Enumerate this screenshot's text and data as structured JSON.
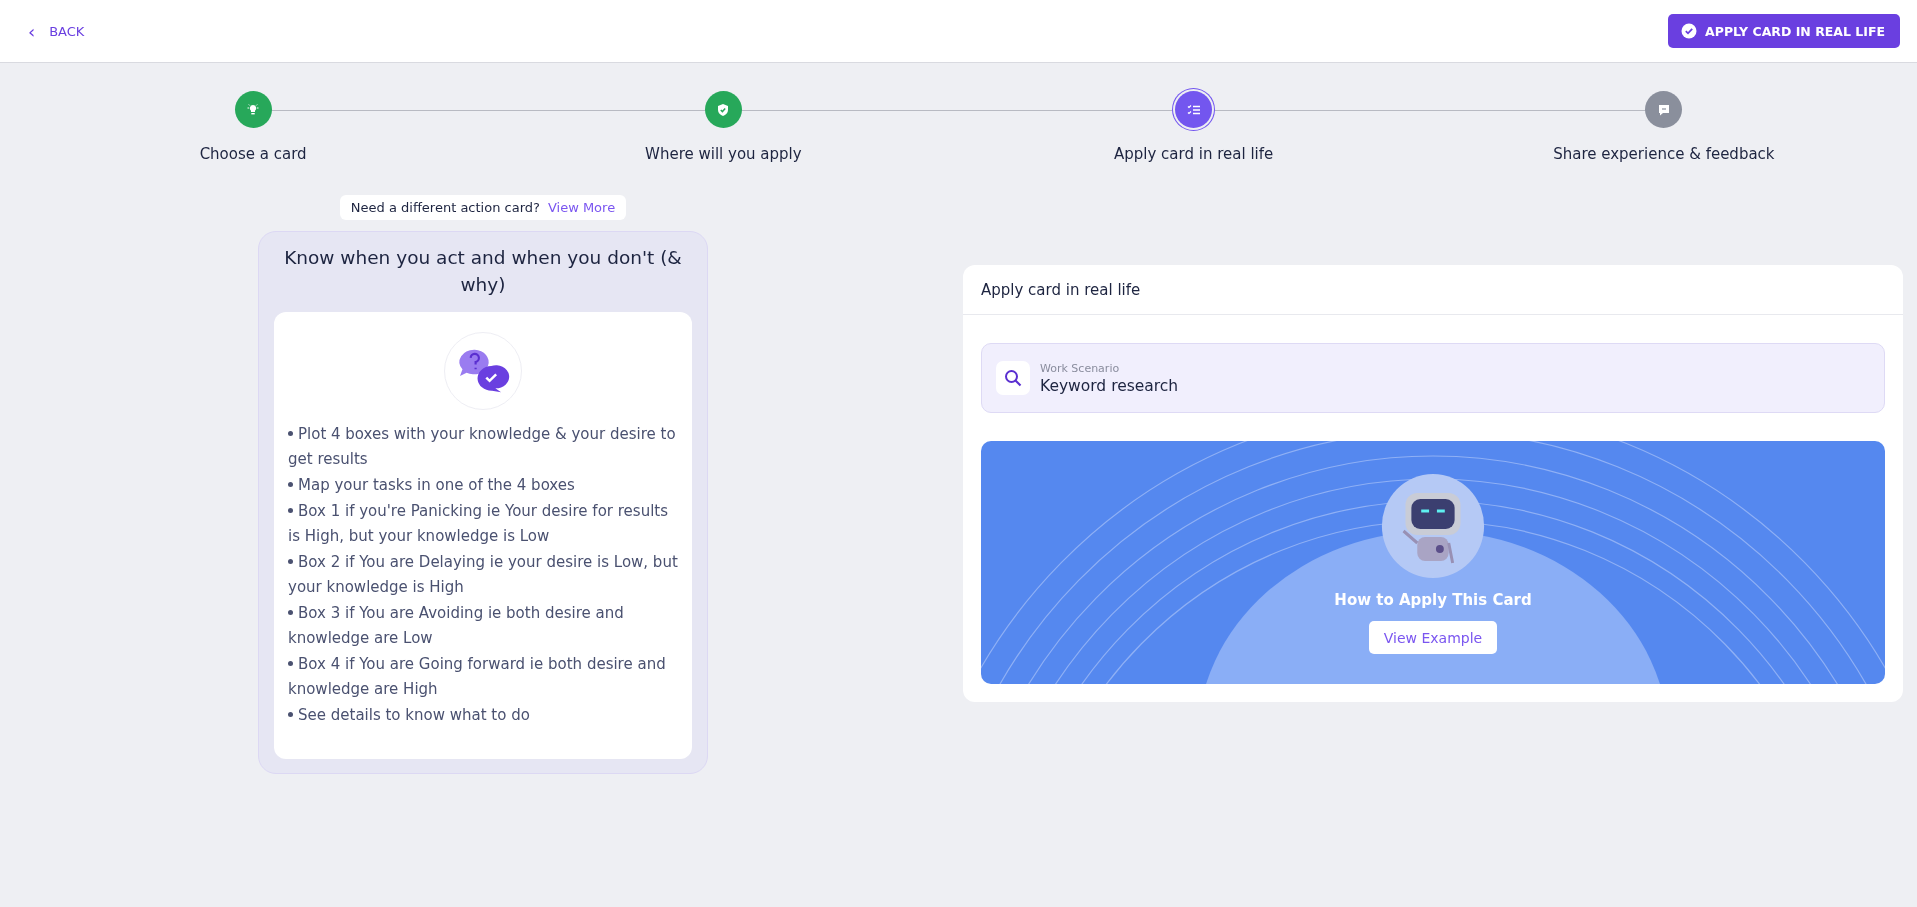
{
  "header": {
    "back": {
      "icon": "‹",
      "label": "BACK"
    },
    "action_button": "APPLY CARD IN REAL LIFE"
  },
  "steps": [
    {
      "label": "Choose a card",
      "kind": "done"
    },
    {
      "label": "Where will you apply",
      "kind": "done"
    },
    {
      "label": "Apply card in real life",
      "kind": "current"
    },
    {
      "label": "Share experience & feedback",
      "kind": "pending"
    }
  ],
  "different_card": {
    "text": "Need a different action card?",
    "link": "View More"
  },
  "action_card": {
    "title": "Know when you act and when you don't (& why)",
    "bullets": [
      "Plot 4 boxes with your knowledge & your desire to get results",
      "Map your tasks in one of the 4 boxes",
      "Box 1 if you're Panicking ie Your desire for results is High, but your knowledge is Low",
      "Box 2 if You are Delaying ie your desire is Low, but your knowledge is High",
      "Box 3 if You are Avoiding ie both desire and knowledge are Low",
      "Box 4 if You are Going forward ie both desire and knowledge are High",
      "See details to know what to do"
    ]
  },
  "apply_panel": {
    "title": "Apply card in real life",
    "scenario": {
      "label": "Work Scenario",
      "value": "Keyword research"
    },
    "banner": {
      "title": "How to Apply This Card",
      "button": "View Example"
    }
  }
}
